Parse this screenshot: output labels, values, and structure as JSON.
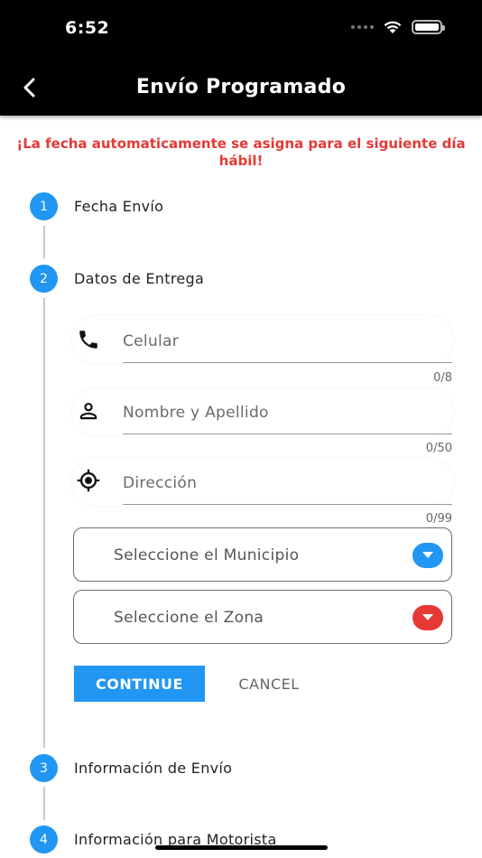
{
  "status_bar": {
    "time": "6:52"
  },
  "app_bar": {
    "title": "Envío Programado",
    "back_icon": "chevron-left-icon"
  },
  "notice": {
    "text": "¡La fecha automaticamente se asigna para el siguiente día hábil!",
    "color": "#e53935"
  },
  "colors": {
    "accent": "#2196f3",
    "error": "#e53935"
  },
  "steps": [
    {
      "number": "1",
      "title": "Fecha Envío"
    },
    {
      "number": "2",
      "title": "Datos de Entrega"
    },
    {
      "number": "3",
      "title": "Información de Envío"
    },
    {
      "number": "4",
      "title": "Información para Motorista"
    }
  ],
  "form": {
    "phone": {
      "placeholder": "Celular",
      "value": "",
      "counter": "0/8",
      "icon": "phone-icon"
    },
    "name": {
      "placeholder": "Nombre y Apellido",
      "value": "",
      "counter": "0/50",
      "icon": "person-icon"
    },
    "address": {
      "placeholder": "Dirección",
      "value": "",
      "counter": "0/99",
      "icon": "location-target-icon"
    },
    "municipio": {
      "label": "Seleccione el Municipio",
      "caret_color": "#2196f3"
    },
    "zona": {
      "label": "Seleccione el Zona",
      "caret_color": "#e53935"
    }
  },
  "actions": {
    "continue_label": "CONTINUE",
    "cancel_label": "CANCEL"
  }
}
